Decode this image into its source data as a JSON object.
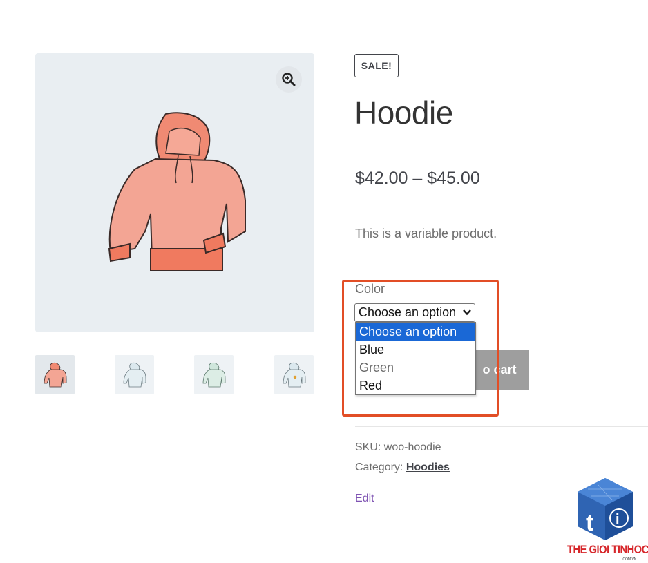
{
  "product": {
    "sale_badge": "SALE!",
    "title": "Hoodie",
    "price": "$42.00 – $45.00",
    "description": "This is a variable product."
  },
  "gallery": {
    "zoom_icon": "zoom-in-icon",
    "thumbnails": [
      "pink",
      "blue",
      "green",
      "blue-logo"
    ]
  },
  "variation": {
    "label": "Color",
    "selected": "Choose an option",
    "options": [
      "Choose an option",
      "Blue",
      "Green",
      "Red"
    ]
  },
  "add_to_cart_partial": "o cart",
  "meta": {
    "sku_label": "SKU:",
    "sku_value": "woo-hoodie",
    "category_label": "Category:",
    "category_value": "Hoodies"
  },
  "edit_link": "Edit",
  "watermark": {
    "text": "THE GIOI TINHOC",
    "sub": ".COM.VN"
  },
  "colors": {
    "sale_badge_border": "#43454b",
    "select_highlight": "#1a68d6",
    "annotation_box": "#e24e26",
    "edit_link": "#7f54b3"
  }
}
